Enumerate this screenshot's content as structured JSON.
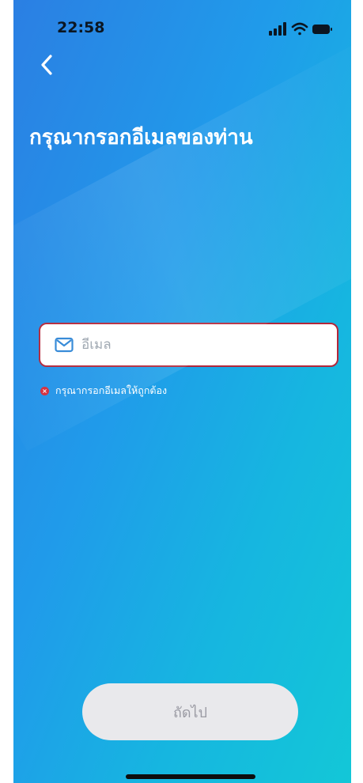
{
  "status_bar": {
    "time": "22:58",
    "icons": [
      "signal-icon",
      "wifi-icon",
      "battery-icon"
    ]
  },
  "header": {
    "back_icon": "chevron-left-icon",
    "title": "กรุณากรอกอีเมลของท่าน"
  },
  "email_field": {
    "icon": "mail-icon",
    "placeholder": "อีเมล",
    "value": "",
    "error_icon": "error-x-icon",
    "error_message": "กรุณากรอกอีเมลให้ถูกต้อง"
  },
  "footer": {
    "next_label": "ถัดไป"
  },
  "colors": {
    "background_gradient_start": "#2b7fe3",
    "background_gradient_end": "#13c7d7",
    "error": "#d42d3c",
    "input_border_error": "#b3273a",
    "icon_blue": "#2f86d6",
    "button_disabled_bg": "#e9e9ec",
    "button_disabled_text": "#9a9aa3"
  }
}
